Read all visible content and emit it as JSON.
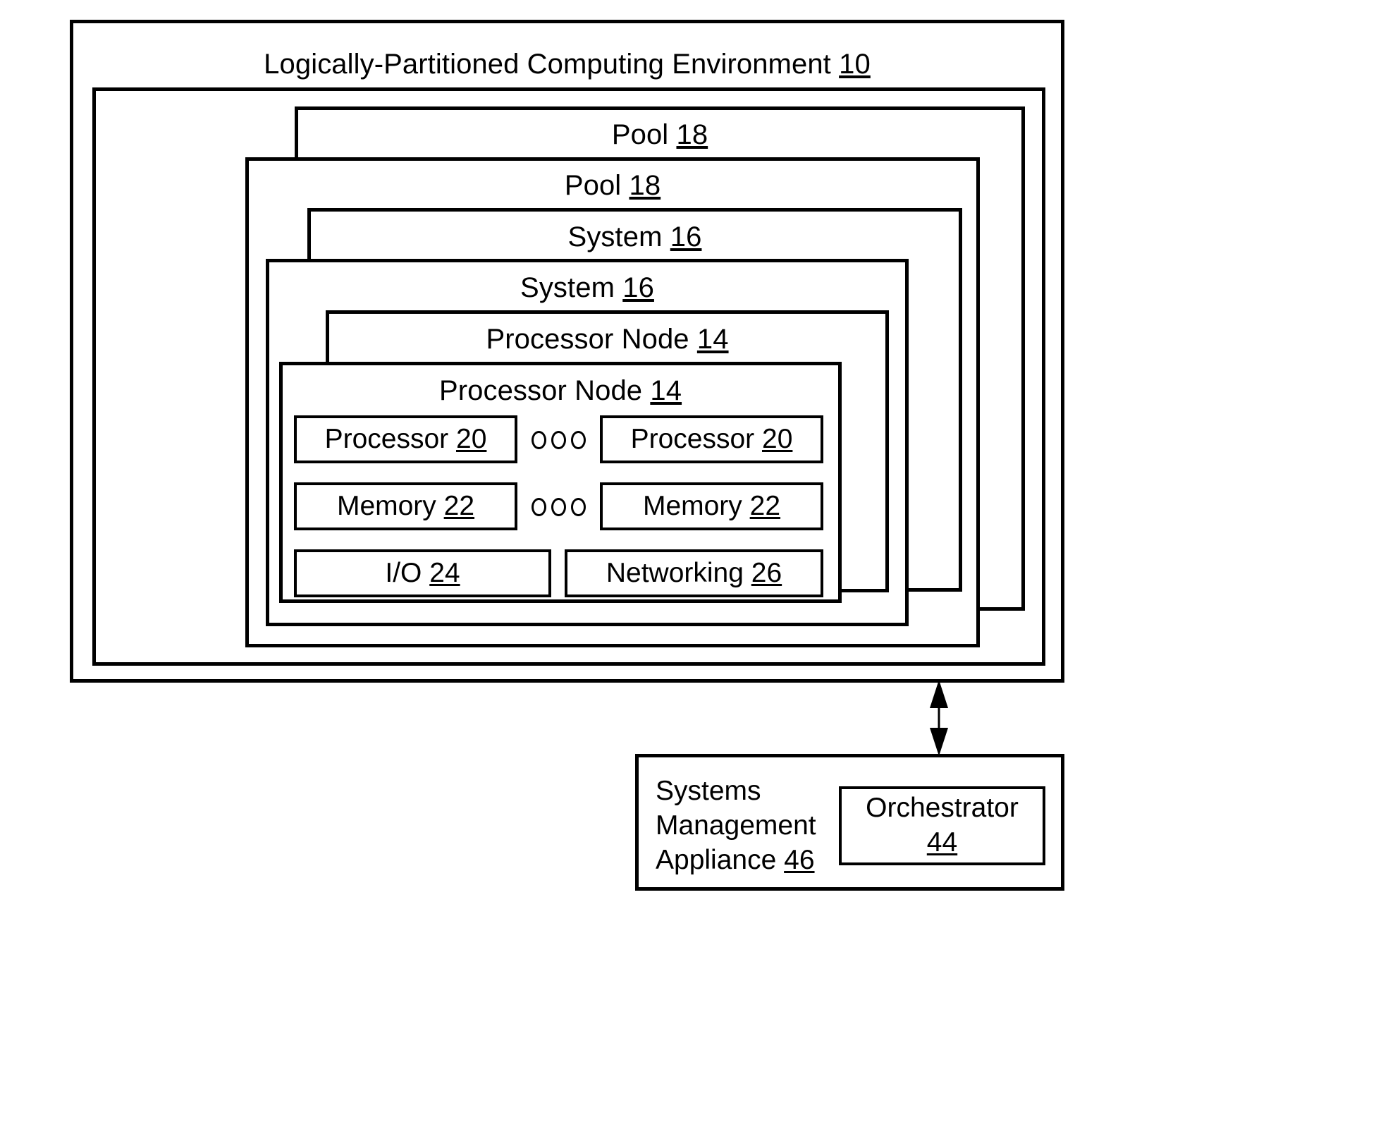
{
  "figure": {
    "type": "patent-block-diagram",
    "background": "#ffffff",
    "line_color": "#000000"
  },
  "environment": {
    "label": "Logically-Partitioned Computing Environment ",
    "ref": "10"
  },
  "cascade": [
    {
      "name": "pool-outer",
      "label": "Pool ",
      "ref": "18"
    },
    {
      "name": "pool-inner",
      "label": "Pool ",
      "ref": "18"
    },
    {
      "name": "system-outer",
      "label": "System ",
      "ref": "16"
    },
    {
      "name": "system-inner",
      "label": "System ",
      "ref": "16"
    },
    {
      "name": "processor-node-outer",
      "label": "Processor Node ",
      "ref": "14"
    },
    {
      "name": "processor-node-inner",
      "label": "Processor Node ",
      "ref": "14"
    }
  ],
  "components": {
    "processor_left": {
      "label": "Processor ",
      "ref": "20"
    },
    "processor_right": {
      "label": "Processor ",
      "ref": "20"
    },
    "memory_left": {
      "label": "Memory ",
      "ref": "22"
    },
    "memory_right": {
      "label": "Memory ",
      "ref": "22"
    },
    "io": {
      "label": "I/O ",
      "ref": "24"
    },
    "networking": {
      "label": "Networking ",
      "ref": "26"
    }
  },
  "ellipsis": {
    "glyph_name": "three-circles-ellipsis",
    "count": 3
  },
  "appliance": {
    "line1": "Systems",
    "line2": "Management",
    "line3": "Appliance  ",
    "ref": "46"
  },
  "orchestrator": {
    "label": "Orchestrator",
    "ref": "44"
  },
  "connector": {
    "name": "bidirectional-arrow",
    "direction": "both"
  }
}
